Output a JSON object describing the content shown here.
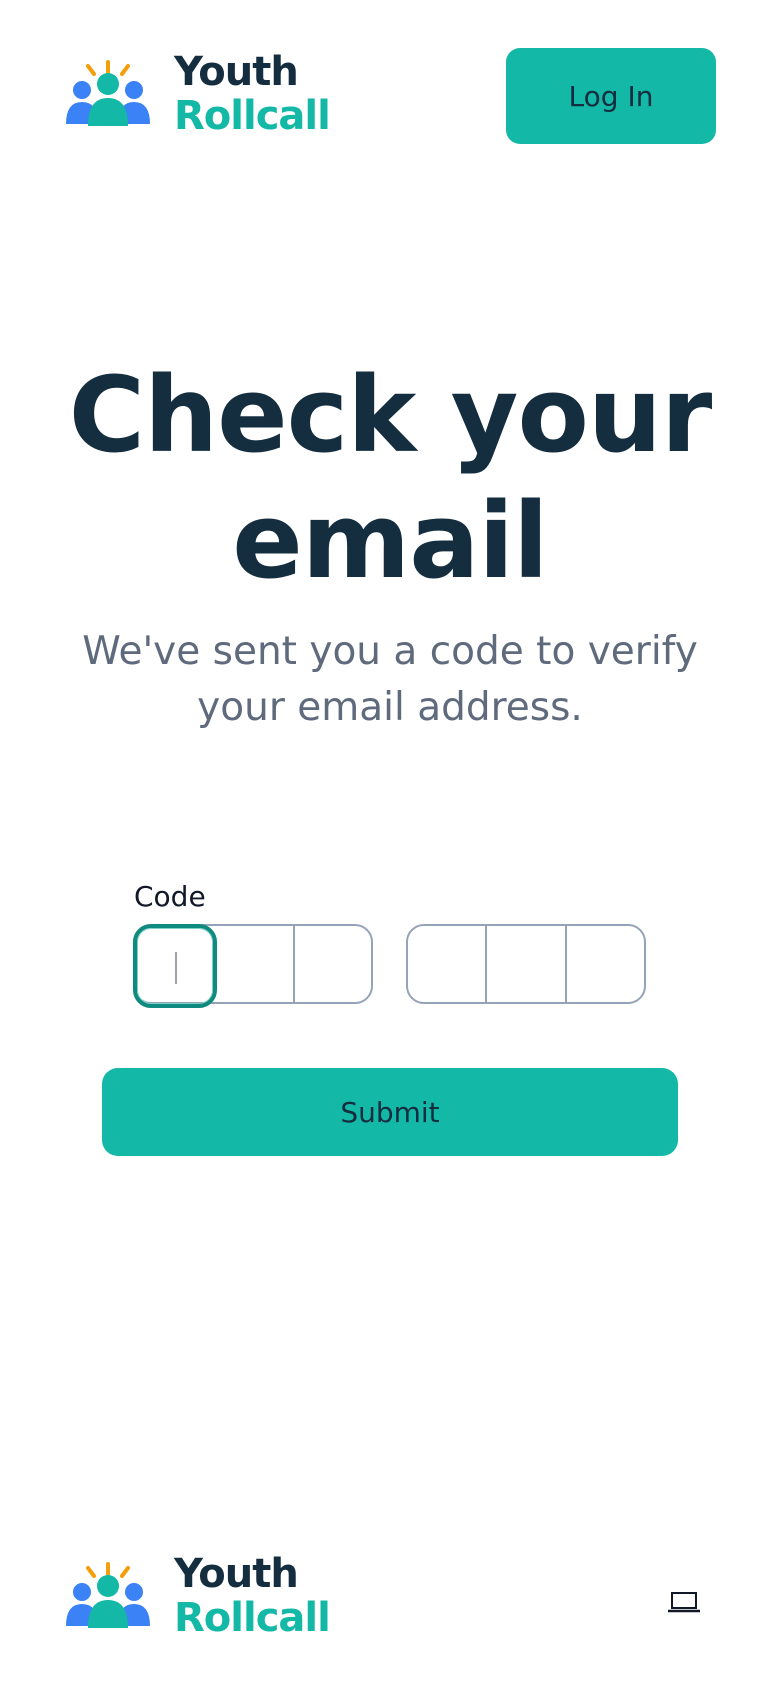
{
  "header": {
    "logo": {
      "line1": "Youth",
      "line2": "Rollcall",
      "icon": "people-group-icon"
    },
    "login_label": "Log In"
  },
  "main": {
    "headline_line1": "Check your",
    "headline_line2": "email",
    "subtext": "We've sent you a code to verify your email address.",
    "code_label": "Code",
    "code_cells": [
      "",
      "",
      "",
      "",
      "",
      ""
    ],
    "submit_label": "Submit"
  },
  "footer": {
    "logo": {
      "line1": "Youth",
      "line2": "Rollcall",
      "icon": "people-group-icon"
    },
    "device_icon": "laptop-icon"
  },
  "colors": {
    "accent": "#14b8a6",
    "navy": "#142d3f",
    "muted": "#5f6b7d",
    "people_blue": "#3b82f6",
    "rays_yellow": "#f59e0b"
  }
}
